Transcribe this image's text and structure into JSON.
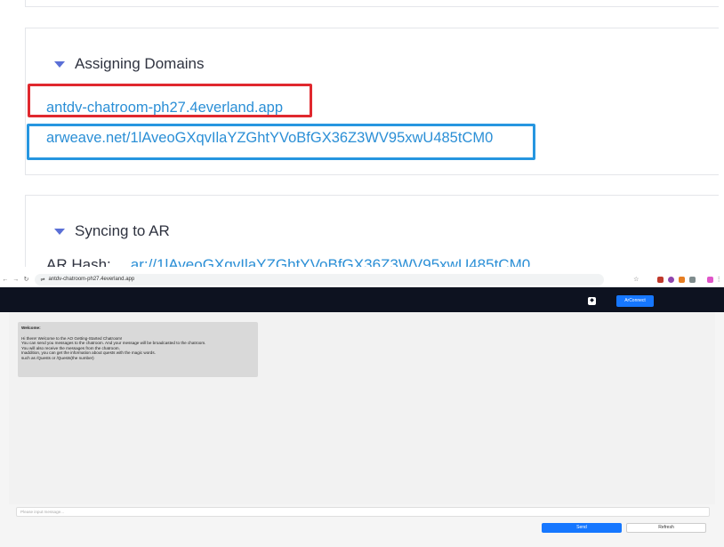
{
  "doc": {
    "assigning": {
      "title": "Assigning Domains",
      "domain_link": "antdv-chatroom-ph27.4everland.app",
      "arweave_link": "arweave.net/1lAveoGXqvIlaYZGhtYVoBfGX36Z3WV95xwU485tCM0"
    },
    "syncing": {
      "title": "Syncing to AR",
      "hash_label": "AR Hash:",
      "hash_value": "ar://1lAveoGXqvIlaYZGhtYVoBfGX36Z3WV95xwU485tCM0"
    }
  },
  "browser": {
    "url": "antdv-chatroom-ph27.4everland.app",
    "back_icon": "back-arrow-icon",
    "forward_icon": "forward-arrow-icon",
    "reload_icon": "reload-icon",
    "star_icon": "star-icon",
    "menu_icon": "kebab-menu-icon",
    "extension_colors": [
      "#c0392b",
      "#8e44ad",
      "#e67e22",
      "#7f8c8d",
      "#e056c9"
    ]
  },
  "app": {
    "connect_label": "ArConnect",
    "messages": [
      {
        "title": "Welcome:",
        "lines": [
          "Hi there! Welcome to the AO Getting-Started Chatroom!",
          "You can send you messages to the chatroom. And your message will be broadcasted to the chatroom.",
          "You will also receive the messages from the chatroom.",
          "Inaddition, you can get the information about quests with the magic words.",
          "such as /Quests or /Quests(the number)"
        ]
      }
    ],
    "input_placeholder": "Please input message...",
    "send_label": "Send",
    "refresh_label": "Refresh"
  }
}
